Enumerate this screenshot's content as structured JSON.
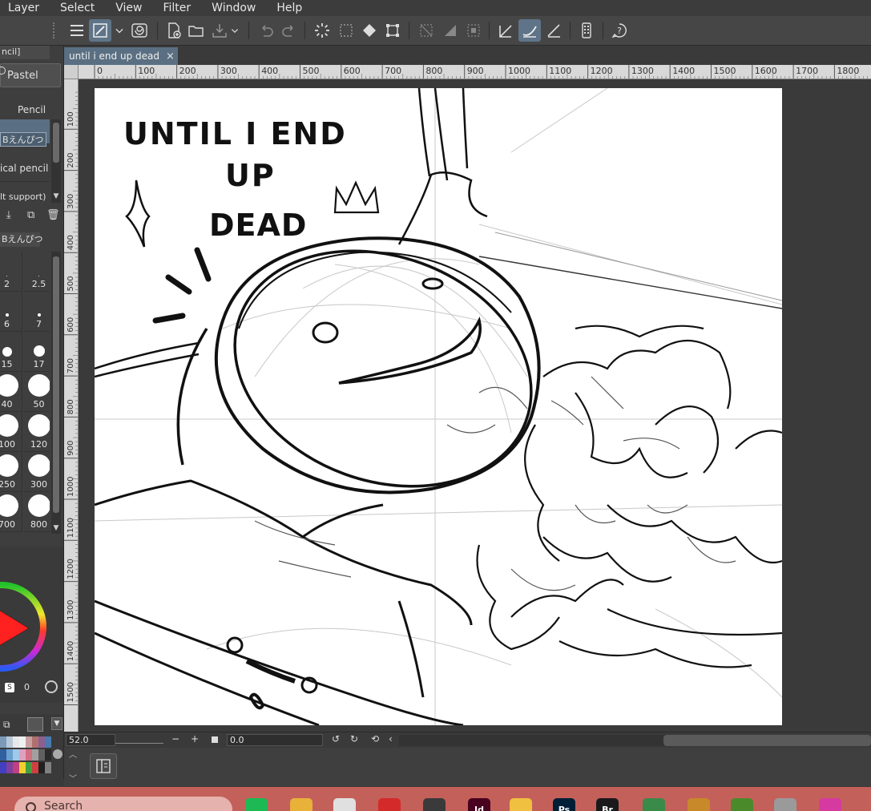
{
  "menu": [
    "Layer",
    "Select",
    "View",
    "Filter",
    "Window",
    "Help"
  ],
  "document": {
    "tab_title": "until i end up dead",
    "close_glyph": "×"
  },
  "subtool": {
    "group_tab": "ncil]",
    "tabs": [
      "Pastel"
    ],
    "section_label": "Pencil",
    "brushes": [
      {
        "label": "Bえんぴつ",
        "selected": true
      },
      {
        "label": "ical pencil",
        "selected": false
      },
      {
        "label": "lt support)",
        "selected": false
      }
    ],
    "detail_tab": "Bえんぴつ"
  },
  "brush_sizes": [
    "2",
    "2.5",
    "6",
    "7",
    "15",
    "17",
    "40",
    "50",
    "100",
    "120",
    "250",
    "300",
    "700",
    "800"
  ],
  "color_panel": {
    "s_label": "S",
    "value": "0"
  },
  "status": {
    "zoom": "52.0",
    "angle": "0.0",
    "minus": "−",
    "plus": "+"
  },
  "ruler_h_labels": [
    "0",
    "100",
    "200",
    "300",
    "400",
    "500",
    "600",
    "700",
    "800",
    "900",
    "1000",
    "1100",
    "1200",
    "1300",
    "1400",
    "1500",
    "1600",
    "1700",
    "1800"
  ],
  "ruler_v_labels": [
    "100",
    "200",
    "300",
    "400",
    "500",
    "600",
    "700",
    "800",
    "900",
    "1000",
    "1100",
    "1200",
    "1300",
    "1400",
    "1500"
  ],
  "artwork": {
    "title_lines": [
      "UNTIL I END",
      "UP",
      "DEAD"
    ]
  },
  "taskbar": {
    "search_placeholder": "Search",
    "apps": [
      {
        "name": "spotify",
        "label": "",
        "color": "#1db954"
      },
      {
        "name": "chrome",
        "label": "",
        "color": "#e8b13a"
      },
      {
        "name": "notepad",
        "label": "",
        "color": "#e0e0e0"
      },
      {
        "name": "opera",
        "label": "",
        "color": "#d42a2a"
      },
      {
        "name": "clip-studio",
        "label": "",
        "color": "#3a3a3a"
      },
      {
        "name": "indesign",
        "label": "Id",
        "color": "#49021f"
      },
      {
        "name": "file-explorer",
        "label": "",
        "color": "#f0c040"
      },
      {
        "name": "photoshop",
        "label": "Ps",
        "color": "#001e36"
      },
      {
        "name": "bridge",
        "label": "Br",
        "color": "#1a1a1a"
      },
      {
        "name": "app-green",
        "label": "",
        "color": "#3a8a4a"
      },
      {
        "name": "app-star",
        "label": "",
        "color": "#c8892a"
      },
      {
        "name": "minecraft",
        "label": "",
        "color": "#4a8a2a"
      },
      {
        "name": "app-gray",
        "label": "",
        "color": "#9a9a9a"
      },
      {
        "name": "app-gradient",
        "label": "",
        "color": "#d63aa0"
      }
    ]
  },
  "colors": {
    "accent": "#5a6f82",
    "panel": "#3e3e3e",
    "taskbar": "#c4605a"
  }
}
